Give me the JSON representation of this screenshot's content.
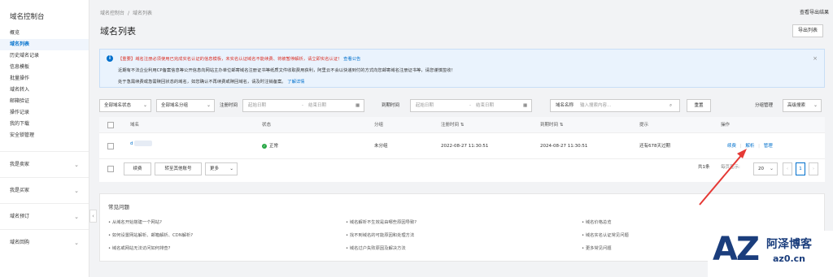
{
  "sidebar": {
    "title": "域名控制台",
    "items": [
      "概览",
      "域名列表",
      "历史域名记录",
      "信息模板",
      "批量操作",
      "域名转入",
      "邮箱验证",
      "操作记录",
      "我的下载",
      "安全锁管理"
    ],
    "groups": [
      "我是卖家",
      "我是买家",
      "域名预订",
      "域名回购"
    ]
  },
  "header": {
    "breadcrumb": [
      "域名控制台",
      "域名列表"
    ],
    "top_link": "查看导出结果",
    "title": "域名列表",
    "export_btn": "导出列表"
  },
  "notice": {
    "line1_red": "【重要】域名注册必须使用已完成实名认证的信息模板，未实名认证域名不能续费、将被暂停解析，请立即实名认证！",
    "line1_link": "查看公告",
    "line2": "近期有不法企业利用CP备案信息等公开信息向网站主办单位邮寄域名注册证书等纸质文件收取费用获利，阿里云不会以快递到付的方式向您邮寄域名注册证书等，请您谨慎签收！",
    "line3": "处于急需续费或急需赎回状态的域名，如您确认不再续费或赎回域名，请及时注销备案。",
    "line3_link": "了解详情"
  },
  "filters": {
    "all_status": "全部域名状态",
    "all_group": "全部域名分组",
    "reg_time_label": "注册时间",
    "start_date": "起始日期",
    "to": "-",
    "end_date": "结束日期",
    "expire_label": "到期时间",
    "domain_name_label": "域名名称",
    "search_placeholder": "输入搜索内容...",
    "reset": "重置",
    "group_manage": "分组管理",
    "advanced": "高级搜索"
  },
  "table": {
    "headers": [
      "域名",
      "状态",
      "分组",
      "注册时间",
      "到期时间",
      "提示",
      "操作"
    ],
    "row": {
      "domain": "d",
      "status": "正常",
      "group": "未分组",
      "reg_time": "2022-08-27 11:30:51",
      "expire_time": "2024-08-27 11:30:51",
      "hint": "还有678天过期",
      "actions": [
        "续费",
        "解析",
        "管理"
      ]
    }
  },
  "pager": {
    "renew": "续费",
    "transfer": "转至其他账号",
    "more": "更多",
    "total": "共1条",
    "per_page_label": "每页显示:",
    "per_page": "20",
    "page": "1"
  },
  "faq": {
    "title": "常见问题",
    "col1": [
      "从域名开始搭建一个网站?",
      "如何设置网站解析、邮箱解析、CDN解析?",
      "域名或网站无法访问如何排查?"
    ],
    "col2": [
      "域名解析不生效是由哪些原因导致?",
      "找不到域名的可能原因和处理方法",
      "域名过户失败原因及解决方法"
    ],
    "col3": [
      "域名价格总览",
      "域名实名认证常见问题",
      "更多常见问题"
    ]
  },
  "watermark": {
    "logo": "AZ",
    "name": "阿泽博客",
    "url": "az0.cn"
  }
}
